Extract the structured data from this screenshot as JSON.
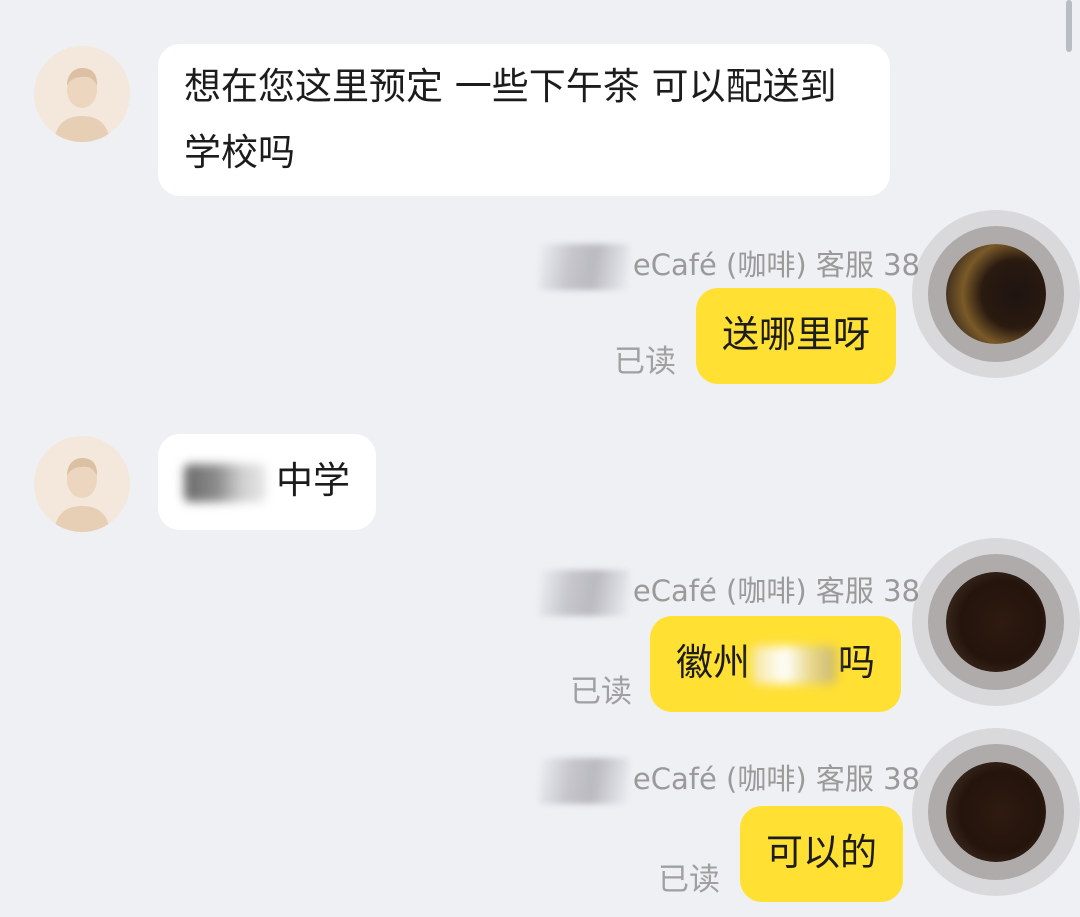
{
  "messages": [
    {
      "from": "customer",
      "text": "想在您这里预定 一些下午茶 可以配送到学校吗"
    },
    {
      "from": "service",
      "sender": "eCafé (咖啡) 客服 38",
      "status": "已读",
      "text": "送哪里呀"
    },
    {
      "from": "customer",
      "text_after_redaction": "中学"
    },
    {
      "from": "service",
      "sender": "eCafé (咖啡) 客服 38",
      "status": "已读",
      "text_before_redaction": "徽州",
      "text_after_redaction": "吗"
    },
    {
      "from": "service",
      "sender": "eCafé (咖啡) 客服 38",
      "status": "已读",
      "text": "可以的"
    }
  ],
  "colors": {
    "background": "#eef0f4",
    "incoming_bubble": "#ffffff",
    "outgoing_bubble": "#ffe033",
    "meta_text": "#9a9a9a"
  },
  "icons": {
    "customer_avatar": "person-avatar-icon",
    "service_avatar": "redacted-avatar"
  }
}
